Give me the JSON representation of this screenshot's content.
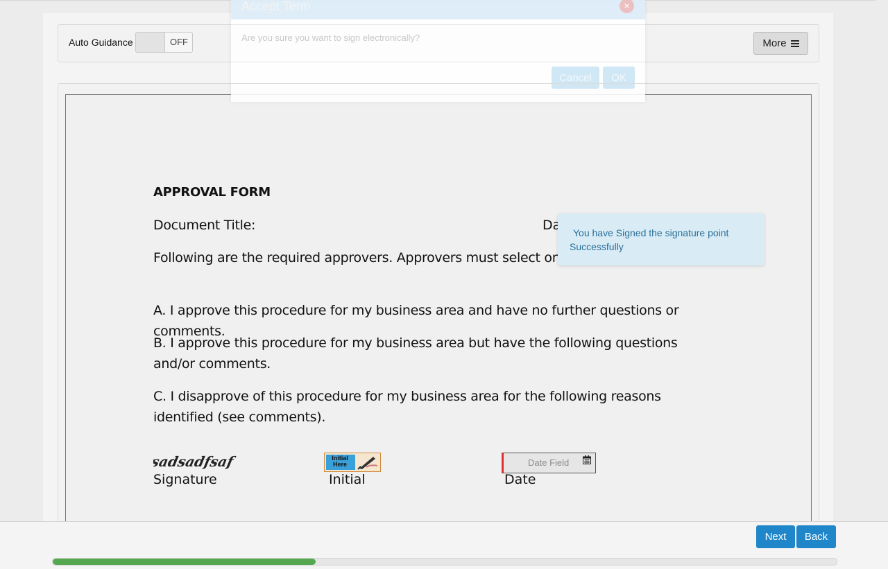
{
  "toolbar": {
    "auto_guidance_label": "Auto Guidance",
    "toggle_state": "OFF",
    "more_label": "More"
  },
  "document": {
    "heading": "APPROVAL FORM",
    "doc_title_label": "Document Title:",
    "date_label_partial": "Da",
    "intro": "Following are the required approvers. Approvers must select one of t reviewing the item:",
    "option_a": "A. I approve this procedure for my business area and have no further questions or comments.",
    "option_b": "B. I approve this procedure for my business area but have the following questions and/or comments.",
    "option_c": "C. I disapprove of this procedure for my business area for the following reasons identified (see comments).",
    "signature_caption": "Signature",
    "initial_caption": "Initial",
    "initial_button_text": "Initial Here",
    "date_caption": "Date",
    "date_field_placeholder": "Date Field",
    "signature_text": "sadsadfsaf"
  },
  "toast": {
    "message": "You have Signed the signature point Successfully"
  },
  "modal": {
    "title": "Accept Term",
    "body": "Are you sure you want to sign electronically?",
    "cancel_label": "Cancel",
    "ok_label": "OK",
    "close_glyph": "×"
  },
  "footer": {
    "next_label": "Next",
    "back_label": "Back",
    "progress_fraction": 0.335
  },
  "colors": {
    "primary_button": "#1f87c9",
    "progress_fill": "#55a84f",
    "toast_bg": "#d9ecf6",
    "date_required_marker": "#e03030"
  }
}
